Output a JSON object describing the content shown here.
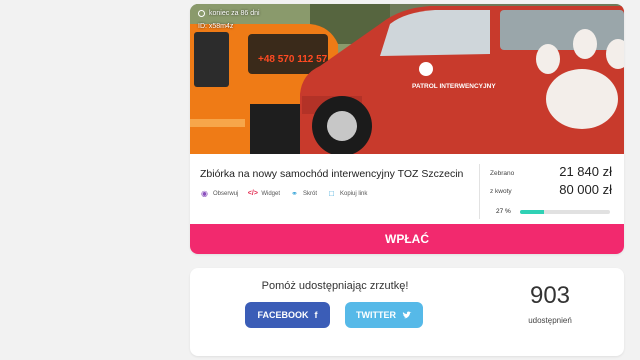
{
  "campaign": {
    "deadline_text": "koniec za 86 dni",
    "id_text": "ID: x58m4z",
    "title": "Zbiórka na nowy samochód interwencyjny TOZ Szczecin",
    "actions": {
      "watch": "Obserwuj",
      "widget": "Widget",
      "share": "Skrót",
      "copy_link": "Kopiuj link"
    },
    "photo": {
      "phone_text": "+48 570 112 57",
      "patrol_text": "PATROL INTERWENCYJNY"
    },
    "stats": {
      "collected_label": "Zebrano",
      "collected_value": "21 840 zł",
      "goal_label": "z kwoty",
      "goal_value": "80 000 zł",
      "percent_text": "27 %",
      "progress_fraction": 0.27
    },
    "donate_label": "WPŁAĆ"
  },
  "share": {
    "title": "Pomóż udostępniając zrzutkę!",
    "facebook_label": "FACEBOOK",
    "twitter_label": "TWITTER",
    "count": "903",
    "count_label": "udostępnień"
  },
  "colors": {
    "accent_pink": "#f2296e",
    "progress_teal": "#2fd1b5",
    "facebook_blue": "#3b5db7",
    "twitter_blue": "#56b9e8"
  },
  "icons": {
    "watch": "eye-icon",
    "widget": "code-icon",
    "share": "link-icon",
    "copy": "copy-icon",
    "facebook": "facebook-icon",
    "twitter": "twitter-icon",
    "deadline": "clock-icon"
  }
}
